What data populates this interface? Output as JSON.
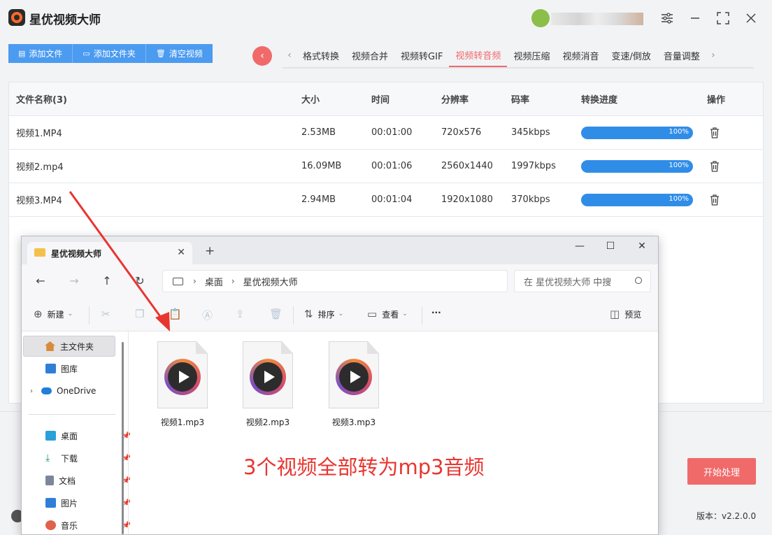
{
  "app": {
    "title": "星优视频大师",
    "version_label": "版本：v2.2.0.0"
  },
  "toolbar": {
    "buttons": [
      {
        "label": "添加文件",
        "icon": "file-icon"
      },
      {
        "label": "添加文件夹",
        "icon": "folder-icon"
      },
      {
        "label": "清空视频",
        "icon": "trash-icon"
      }
    ]
  },
  "tabs": {
    "items": [
      "格式转换",
      "视频合并",
      "视频转GIF",
      "视频转音频",
      "视频压缩",
      "视频消音",
      "变速/倒放",
      "音量调整"
    ],
    "active": "视频转音频"
  },
  "table": {
    "headers": [
      "文件名称(3)",
      "大小",
      "时间",
      "分辨率",
      "码率",
      "转换进度",
      "操作"
    ],
    "rows": [
      {
        "name": "视频1.MP4",
        "size": "2.53MB",
        "time": "00:01:00",
        "res": "720x576",
        "bitrate": "345kbps",
        "progress": "100%"
      },
      {
        "name": "视频2.mp4",
        "size": "16.09MB",
        "time": "00:01:06",
        "res": "2560x1440",
        "bitrate": "1997kbps",
        "progress": "100%"
      },
      {
        "name": "视频3.MP4",
        "size": "2.94MB",
        "time": "00:01:04",
        "res": "1920x1080",
        "bitrate": "370kbps",
        "progress": "100%"
      }
    ]
  },
  "start_button": "开始处理",
  "explorer": {
    "tab_title": "星优视频大师",
    "breadcrumb": [
      "桌面",
      "星优视频大师"
    ],
    "search_placeholder": "在 星优视频大师 中搜",
    "commands": {
      "new": "新建",
      "sort": "排序",
      "view": "查看",
      "more": "···",
      "preview": "预览"
    },
    "sidebar": [
      {
        "label": "主文件夹",
        "icon": "home-icon"
      },
      {
        "label": "图库",
        "icon": "gallery-icon"
      },
      {
        "label": "OneDrive",
        "icon": "cloud-icon"
      },
      {
        "label": "桌面",
        "icon": "desktop-icon"
      },
      {
        "label": "下载",
        "icon": "download-icon"
      },
      {
        "label": "文档",
        "icon": "document-icon"
      },
      {
        "label": "图片",
        "icon": "pictures-icon"
      },
      {
        "label": "音乐",
        "icon": "music-icon"
      }
    ],
    "files": [
      "视频1.mp3",
      "视频2.mp3",
      "视频3.mp3"
    ]
  },
  "annotation": {
    "text": "3个视频全部转为mp3音频",
    "color": "#e8352f"
  },
  "colors": {
    "primary_blue": "#4b9bf0",
    "accent_red": "#f06a6a",
    "progress_blue": "#2f8de8"
  }
}
